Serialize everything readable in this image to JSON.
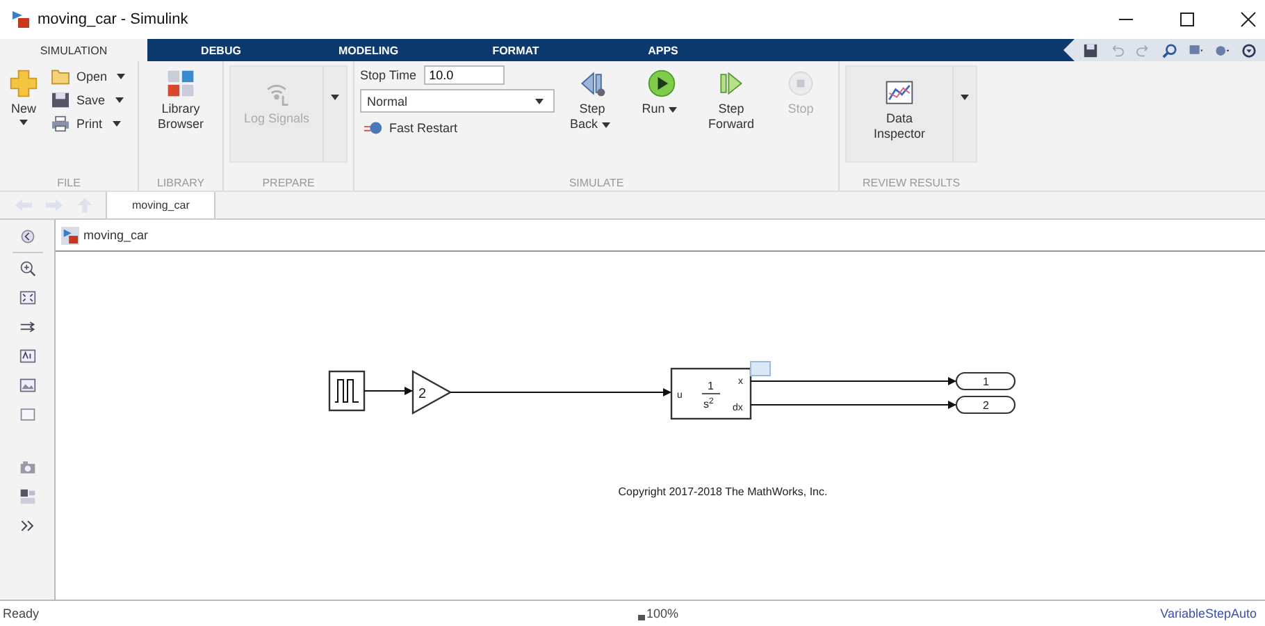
{
  "window": {
    "title": "moving_car - Simulink"
  },
  "tabs": [
    {
      "label": "SIMULATION",
      "selected": true
    },
    {
      "label": "DEBUG",
      "selected": false
    },
    {
      "label": "MODELING",
      "selected": false
    },
    {
      "label": "FORMAT",
      "selected": false
    },
    {
      "label": "APPS",
      "selected": false
    }
  ],
  "ribbon": {
    "file": {
      "title": "FILE",
      "new": "New",
      "open": "Open",
      "save": "Save",
      "print": "Print"
    },
    "library": {
      "title": "LIBRARY",
      "browser": "Library Browser"
    },
    "prepare": {
      "title": "PREPARE",
      "log_signals": {
        "label": "Log Signals",
        "disabled": true
      }
    },
    "simulate": {
      "title": "SIMULATE",
      "stop_time_label": "Stop Time",
      "stop_time": "10.0",
      "mode": "Normal",
      "fast_restart": "Fast Restart",
      "buttons": [
        {
          "kind": "step_back",
          "label": "Step Back",
          "dropdown": true,
          "disabled": false
        },
        {
          "kind": "run",
          "label": "Run",
          "dropdown": true,
          "disabled": false
        },
        {
          "kind": "step_forward",
          "label": "Step Forward",
          "dropdown": false,
          "disabled": false
        },
        {
          "kind": "stop",
          "label": "Stop",
          "dropdown": false,
          "disabled": true
        }
      ]
    },
    "review": {
      "title": "REVIEW RESULTS",
      "data_inspector": "Data Inspector"
    }
  },
  "breadcrumb": {
    "tab": "moving_car"
  },
  "address": {
    "path": "moving_car"
  },
  "diagram": {
    "gain": "2",
    "integrator": {
      "input": "u",
      "numerator": "1",
      "denominator": "s",
      "power": "2",
      "out1": "x",
      "out2": "dx"
    },
    "outports": [
      "1",
      "2"
    ],
    "copyright": "Copyright 2017-2018 The MathWorks, Inc."
  },
  "status_bar": {
    "state": "Ready",
    "zoom": "100%",
    "solver": "VariableStepAuto"
  }
}
